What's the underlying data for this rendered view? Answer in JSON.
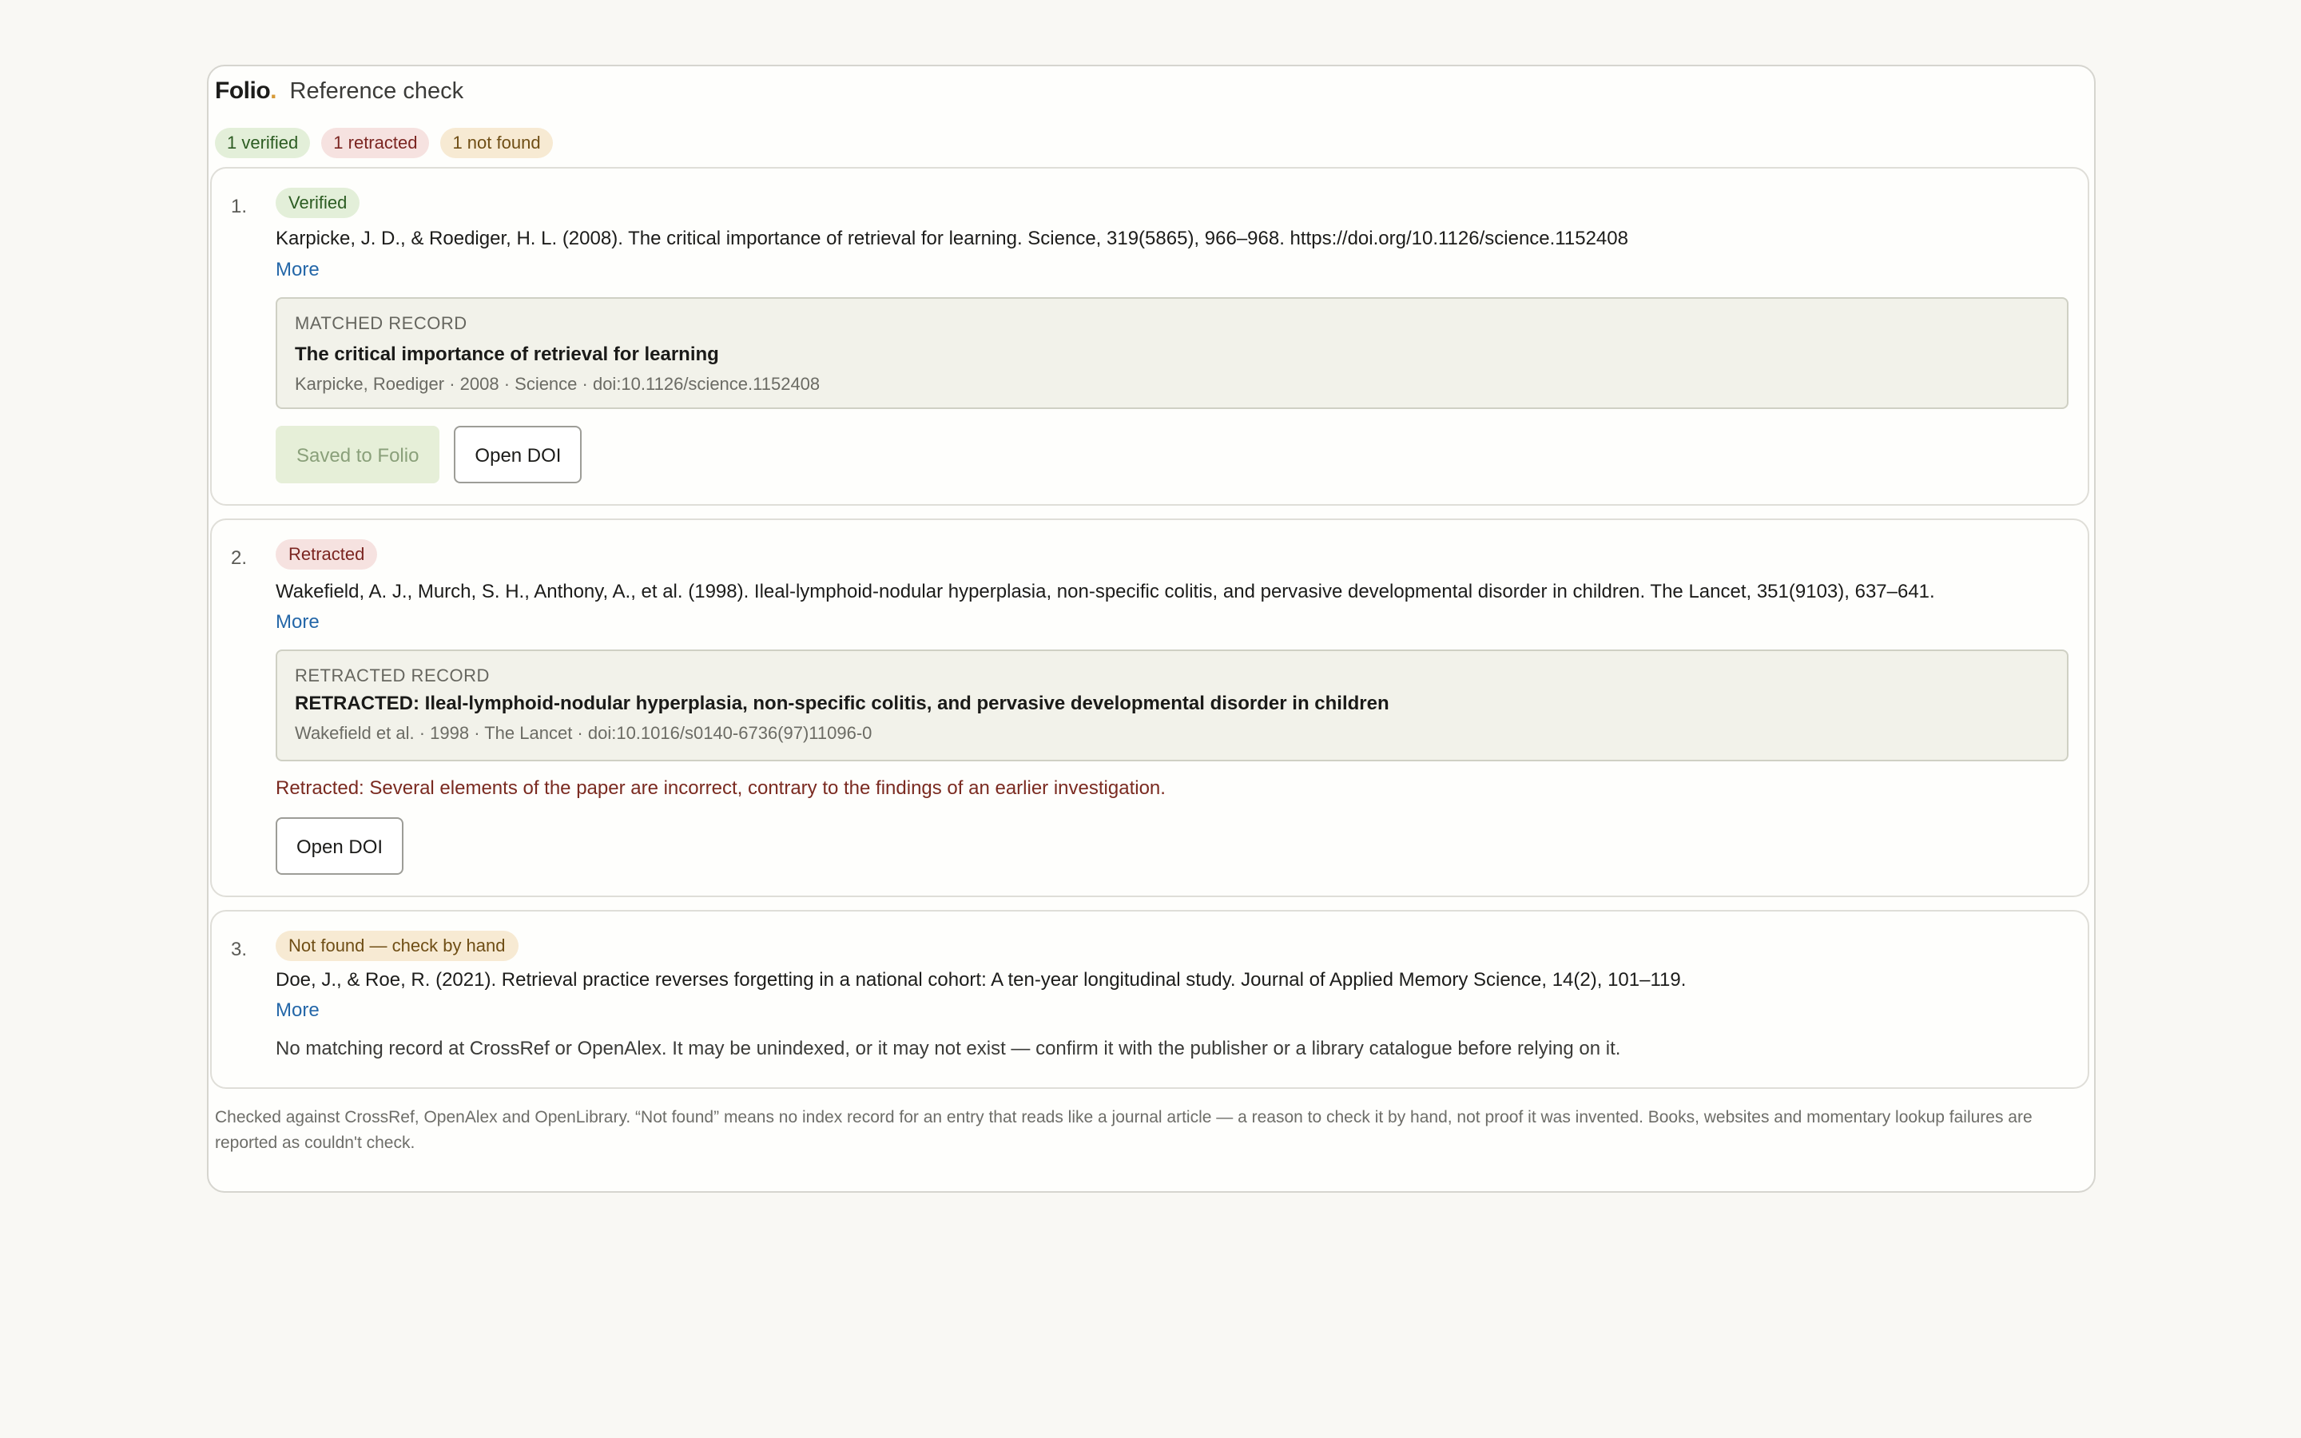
{
  "header": {
    "brand": "Folio",
    "brand_dot": ".",
    "title": "Reference check"
  },
  "summary": {
    "verified": "1 verified",
    "retracted": "1 retracted",
    "not_found": "1 not found"
  },
  "colors": {
    "verified_bg": "#e3efd9",
    "retracted_bg": "#f6e2e0",
    "not_found_bg": "#f7ead3",
    "link": "#2467a8",
    "retraction_text": "#7a2a20",
    "brand_dot": "#d69a38"
  },
  "references": [
    {
      "number": "1.",
      "status": "Verified",
      "citation": "Karpicke, J. D., & Roediger, H. L. (2008). The critical importance of retrieval for learning. Science, 319(5865), 966–968. https://doi.org/10.1126/science.1152408",
      "more": "More",
      "record_label": "MATCHED RECORD",
      "record_title": "The critical importance of retrieval for learning",
      "record_meta": "Karpicke, Roediger · 2008 · Science · doi:10.1126/science.1152408",
      "save_label": "Saved to Folio",
      "open_label": "Open DOI"
    },
    {
      "number": "2.",
      "status": "Retracted",
      "citation": "Wakefield, A. J., Murch, S. H., Anthony, A., et al. (1998). Ileal-lymphoid-nodular hyperplasia, non-specific colitis, and pervasive developmental disorder in children. The Lancet, 351(9103), 637–641.",
      "more": "More",
      "record_label": "RETRACTED RECORD",
      "record_title": "RETRACTED: Ileal-lymphoid-nodular hyperplasia, non-specific colitis, and pervasive developmental disorder in children",
      "record_meta": "Wakefield et al. · 1998 · The Lancet · doi:10.1016/s0140-6736(97)11096-0",
      "reason": "Retracted: Several elements of the paper are incorrect, contrary to the findings of an earlier investigation.",
      "open_label": "Open DOI"
    },
    {
      "number": "3.",
      "status": "Not found — check by hand",
      "citation": "Doe, J., & Roe, R. (2021). Retrieval practice reverses forgetting in a national cohort: A ten-year longitudinal study. Journal of Applied Memory Science, 14(2), 101–119.",
      "more": "More",
      "note": "No matching record at CrossRef or OpenAlex. It may be unindexed, or it may not exist — confirm it with the publisher or a library catalogue before relying on it."
    }
  ],
  "footer": "Checked against CrossRef, OpenAlex and OpenLibrary. “Not found” means no index record for an entry that reads like a journal article — a reason to check it by hand, not proof it was invented. Books, websites and momentary lookup failures are reported as couldn't check."
}
